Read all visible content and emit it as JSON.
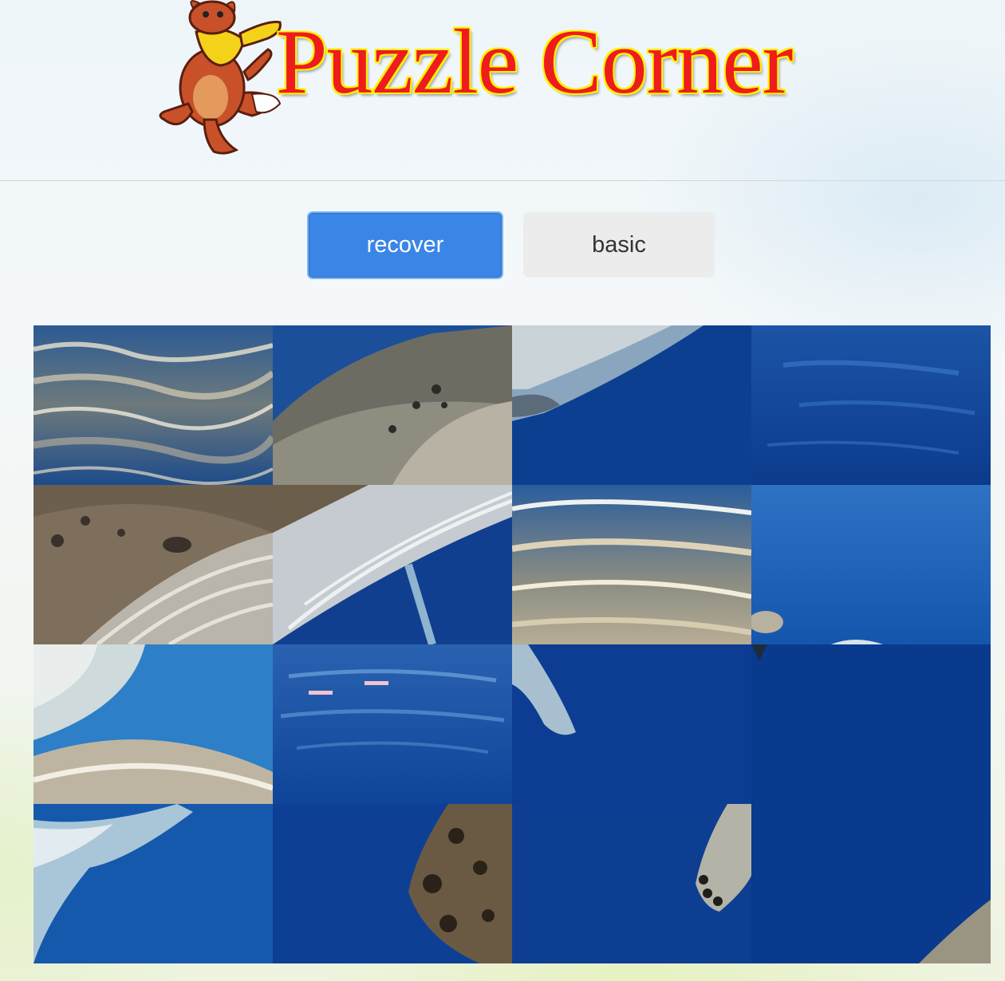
{
  "header": {
    "title": "Puzzle Corner",
    "mascot": "kangaroo-mascot-icon"
  },
  "controls": {
    "recover_label": "recover",
    "basic_label": "basic"
  },
  "puzzle": {
    "rows": 4,
    "columns": 4,
    "image_subject": "humpback whale underwater",
    "tiles": [
      {
        "row": 1,
        "col": 1,
        "style": "surface"
      },
      {
        "row": 1,
        "col": 2,
        "style": "whale-back"
      },
      {
        "row": 1,
        "col": 3,
        "style": "whale-belly-edge"
      },
      {
        "row": 1,
        "col": 4,
        "style": "deep-ripple"
      },
      {
        "row": 2,
        "col": 1,
        "style": "whale-head"
      },
      {
        "row": 2,
        "col": 2,
        "style": "whale-throat"
      },
      {
        "row": 2,
        "col": 3,
        "style": "surface-bright"
      },
      {
        "row": 2,
        "col": 4,
        "style": "open-blue"
      },
      {
        "row": 3,
        "col": 1,
        "style": "whale-splash"
      },
      {
        "row": 3,
        "col": 2,
        "style": "blue-ripple"
      },
      {
        "row": 3,
        "col": 3,
        "style": "fin-tip"
      },
      {
        "row": 3,
        "col": 4,
        "style": "deep"
      },
      {
        "row": 4,
        "col": 1,
        "style": "tail-fluke"
      },
      {
        "row": 4,
        "col": 2,
        "style": "whale-knobs"
      },
      {
        "row": 4,
        "col": 3,
        "style": "fin-knobs"
      },
      {
        "row": 4,
        "col": 4,
        "style": "deep-corner"
      }
    ]
  },
  "colors": {
    "accent": "#3a86e6",
    "title_red": "#ee1c1c",
    "title_outline": "#fff200",
    "deep_ocean": "#0b3d8f"
  }
}
